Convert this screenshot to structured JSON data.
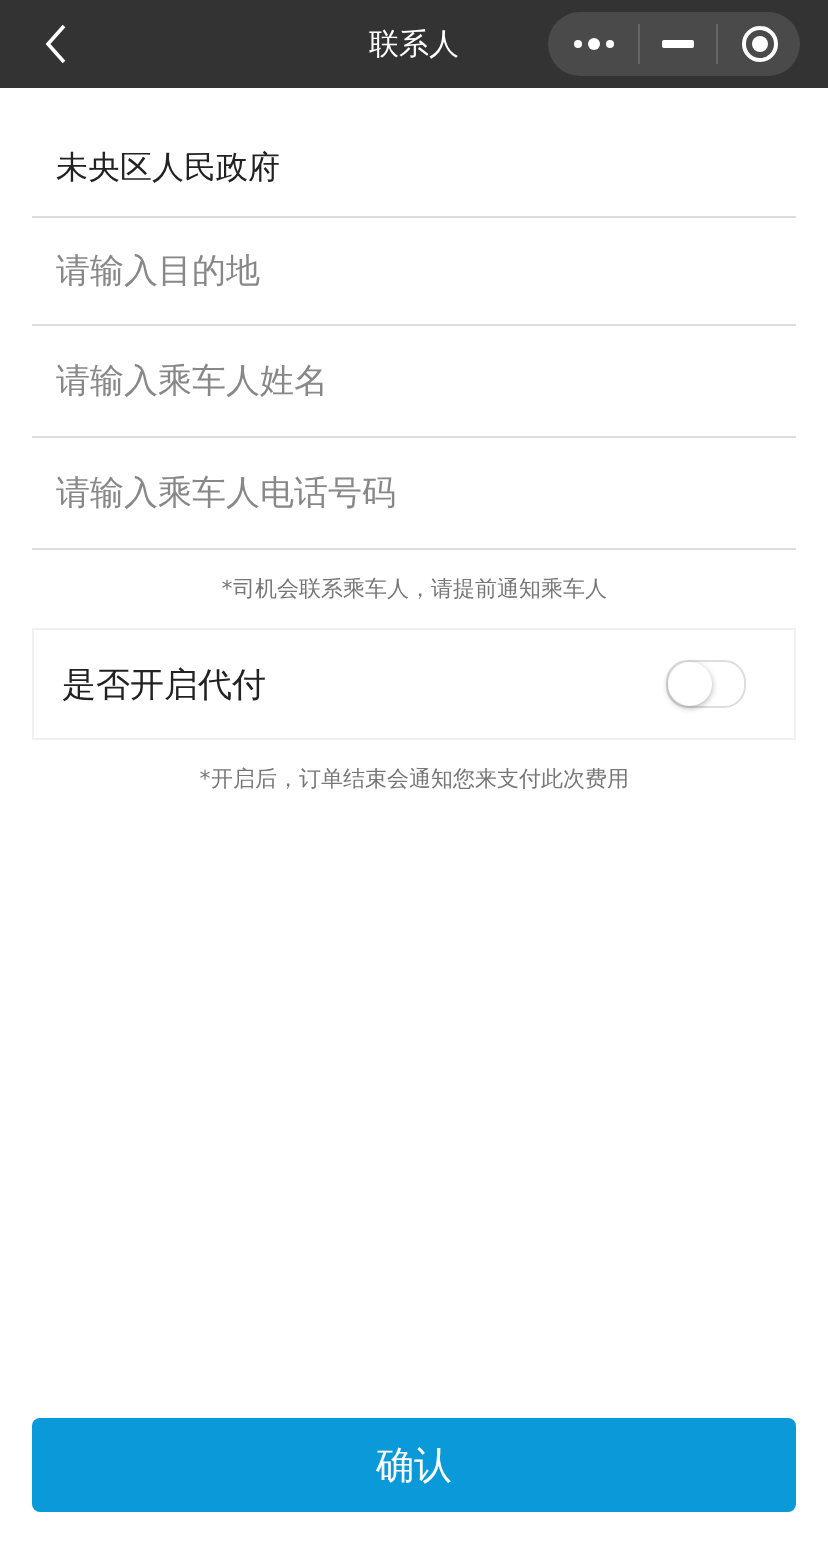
{
  "nav_bar": {
    "title": "联系人"
  },
  "fields": [
    {
      "value": "未央区人民政府"
    },
    {
      "placeholder": "请输入目的地"
    },
    {
      "placeholder": "请输入乘车人姓名"
    },
    {
      "placeholder": "请输入乘车人电话号码"
    }
  ],
  "driver_note": "*司机会联系乘车人，请提前通知乘车人",
  "pay_for_other": {
    "label": "是否开启代付",
    "on": false
  },
  "pay_note": "*开启后，订单结束会通知您来支付此次费用",
  "confirm_button": "确认"
}
